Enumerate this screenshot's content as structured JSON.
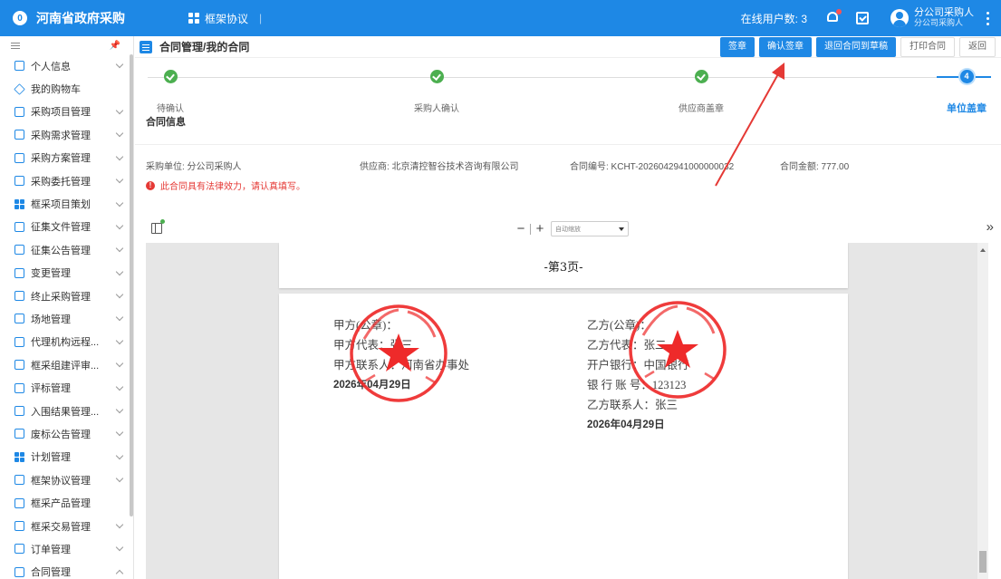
{
  "app": {
    "title": "河南省政府采购",
    "logo_glyph": "0",
    "module": "框架协议",
    "separator": "|"
  },
  "topbar": {
    "online_label": "在线用户数: 3",
    "user_name": "分公司采购人",
    "user_role": "分公司采购人"
  },
  "sidebar": {
    "items": [
      {
        "label": "个人信息",
        "icon": "user-card-icon",
        "chevron": "down"
      },
      {
        "label": "我的购物车",
        "icon": "diamond-icon",
        "chevron": ""
      },
      {
        "label": "采购项目管理",
        "icon": "folder-icon",
        "chevron": "down"
      },
      {
        "label": "采购需求管理",
        "icon": "document-icon",
        "chevron": "down"
      },
      {
        "label": "采购方案管理",
        "icon": "document-icon",
        "chevron": "down"
      },
      {
        "label": "采购委托管理",
        "icon": "document-icon",
        "chevron": "down"
      },
      {
        "label": "框采项目策划",
        "icon": "grid-icon",
        "chevron": "down"
      },
      {
        "label": "征集文件管理",
        "icon": "document-icon",
        "chevron": "down"
      },
      {
        "label": "征集公告管理",
        "icon": "document-icon",
        "chevron": "down"
      },
      {
        "label": "变更管理",
        "icon": "document-icon",
        "chevron": "down"
      },
      {
        "label": "终止采购管理",
        "icon": "document-icon",
        "chevron": "down"
      },
      {
        "label": "场地管理",
        "icon": "document-icon",
        "chevron": "down"
      },
      {
        "label": "代理机构远程...",
        "icon": "document-icon",
        "chevron": "down"
      },
      {
        "label": "框采组建评审...",
        "icon": "people-icon",
        "chevron": "down"
      },
      {
        "label": "评标管理",
        "icon": "document-icon",
        "chevron": "down"
      },
      {
        "label": "入围结果管理...",
        "icon": "document-icon",
        "chevron": "down"
      },
      {
        "label": "废标公告管理",
        "icon": "document-icon",
        "chevron": "down"
      },
      {
        "label": "计划管理",
        "icon": "grid-icon",
        "chevron": "down"
      },
      {
        "label": "框架协议管理",
        "icon": "document-icon",
        "chevron": "down"
      },
      {
        "label": "框采产品管理",
        "icon": "document-icon",
        "chevron": ""
      },
      {
        "label": "框采交易管理",
        "icon": "document-icon",
        "chevron": "down"
      },
      {
        "label": "订单管理",
        "icon": "document-icon",
        "chevron": "down"
      },
      {
        "label": "合同管理",
        "icon": "document-icon",
        "chevron": "up"
      }
    ]
  },
  "page": {
    "title": "合同管理/我的合同"
  },
  "buttons": {
    "sign": "签章",
    "confirm_sign": "确认签章",
    "return_draft": "退回合同到草稿",
    "print": "打印合同",
    "back": "返回"
  },
  "steps": [
    {
      "label": "待确认",
      "state": "done"
    },
    {
      "label": "采购人确认",
      "state": "done"
    },
    {
      "label": "供应商盖章",
      "state": "done"
    },
    {
      "label": "单位盖章",
      "state": "active",
      "number": "4"
    }
  ],
  "contract": {
    "section_title": "合同信息",
    "purchaser": "采购单位: 分公司采购人",
    "supplier": "供应商: 北京清控智谷技术咨询有限公司",
    "number": "合同编号: KCHT-2026042941000000032",
    "amount": "合同金额: 777.00",
    "warning": "此合同具有法律效力，请认真填写。",
    "warning_glyph": "!"
  },
  "viewer": {
    "zoom_label": "自动缩放",
    "zoom_minus": "−",
    "zoom_plus": "+",
    "expand": "»",
    "page3_label": "-第3页-",
    "party_a": {
      "line1": "甲方(公章)：",
      "line2": "甲方代表：张三",
      "line3": "甲方联系人：河南省办事处",
      "date": "2026年04月29日"
    },
    "party_b": {
      "line1": "乙方(公章)：",
      "line2": "乙方代表：张二",
      "line3": "开户银行：中国银行",
      "line4": "银 行 账 号：123123",
      "line5": "乙方联系人：张三",
      "date": "2026年04月29日"
    }
  },
  "colors": {
    "primary": "#1e88e5",
    "success": "#4caf50",
    "danger": "#e53935",
    "seal": "#ee2a2a"
  }
}
